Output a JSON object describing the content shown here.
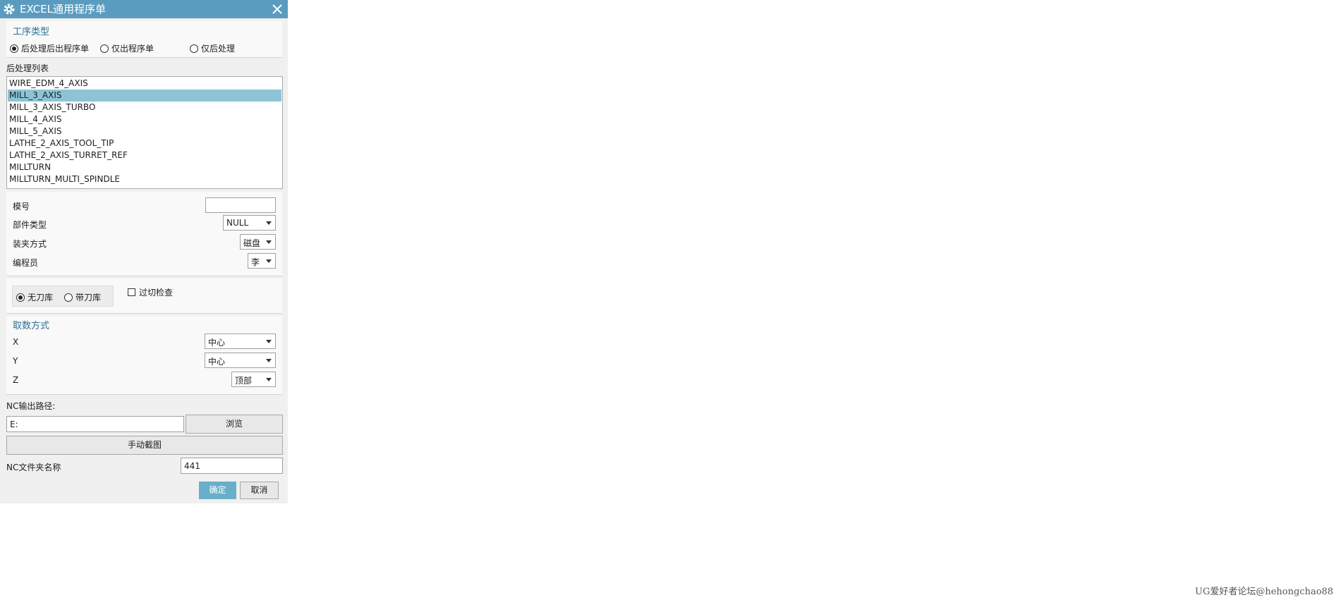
{
  "title_bar": {
    "title": "EXCEL通用程序单",
    "icon": "gear-icon",
    "close_icon": "close-icon"
  },
  "operation_type": {
    "title": "工序类型",
    "options": [
      {
        "label": "后处理后出程序单",
        "selected": true
      },
      {
        "label": "仅出程序单",
        "selected": false
      },
      {
        "label": "仅后处理",
        "selected": false
      }
    ]
  },
  "post_list": {
    "label": "后处理列表",
    "items": [
      "WIRE_EDM_4_AXIS",
      "MILL_3_AXIS",
      "MILL_3_AXIS_TURBO",
      "MILL_4_AXIS",
      "MILL_5_AXIS",
      "LATHE_2_AXIS_TOOL_TIP",
      "LATHE_2_AXIS_TURRET_REF",
      "MILLTURN",
      "MILLTURN_MULTI_SPINDLE"
    ],
    "selected_index": 1
  },
  "part_info": {
    "mold_no_label": "模号",
    "mold_no_value": "",
    "part_type_label": "部件类型",
    "part_type_value": "NULL",
    "clamp_label": "装夹方式",
    "clamp_value": "磁盘",
    "programmer_label": "编程员",
    "programmer_value": "李"
  },
  "tool_library": {
    "options": [
      {
        "label": "无刀库",
        "selected": true
      },
      {
        "label": "带刀库",
        "selected": false
      }
    ],
    "overcut_label": "过切检查",
    "overcut_checked": false
  },
  "fetch_method": {
    "title": "取数方式",
    "x_label": "X",
    "x_value": "中心",
    "y_label": "Y",
    "y_value": "中心",
    "z_label": "Z",
    "z_value": "顶部"
  },
  "nc_output": {
    "path_label": "NC输出路径:",
    "path_value": "E:",
    "browse_label": "浏览",
    "manual_capture_label": "手动截图",
    "folder_label": "NC文件夹名称",
    "folder_value": "441"
  },
  "actions": {
    "ok_label": "确定",
    "cancel_label": "取消"
  },
  "colors": {
    "title_bar": "#5a9cc0",
    "selected_row": "#8cc4d6",
    "accent_text": "#2a6f98",
    "primary_button": "#6aafca"
  },
  "watermark": "UG爱好者论坛@hehongchao88"
}
